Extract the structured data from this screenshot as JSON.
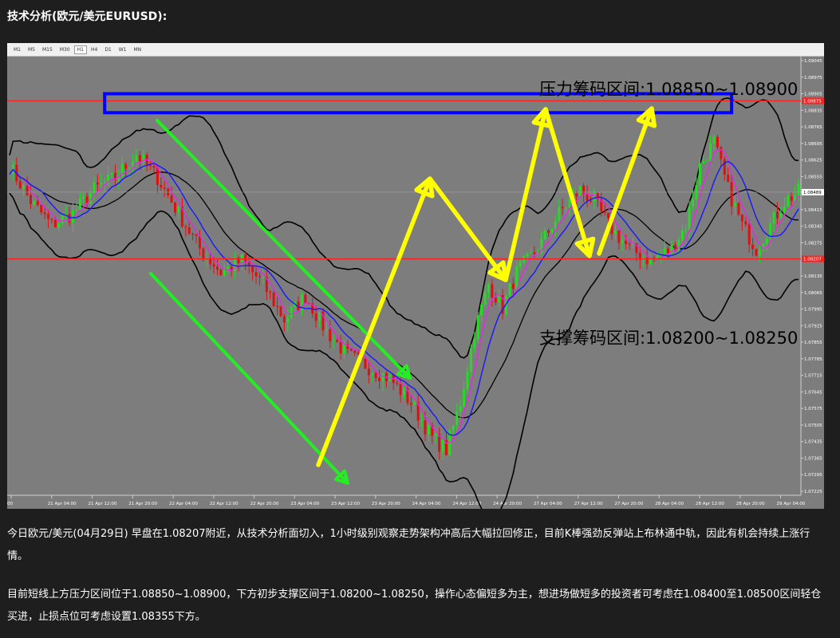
{
  "heading": "技术分析(欧元/美元EURUSD):",
  "timeframes": [
    "M1",
    "M5",
    "M15",
    "M30",
    "H1",
    "H4",
    "D1",
    "W1",
    "MN"
  ],
  "active_timeframe": "H1",
  "colors": {
    "background": "#1e1e1e",
    "chart_bg": "#7d7d7d",
    "up_candle": "#22dd22",
    "down_candle": "#e01010",
    "band_line": "#000000",
    "mid_line": "#1818ff",
    "ma_line": "#ee22ee",
    "level_line": "#ff2020",
    "resistance_box": "#0000ff",
    "arrow_yellow": "#ffff00",
    "channel_green": "#22ee22"
  },
  "chart_data": {
    "type": "candlestick",
    "symbol": "EURUSD",
    "timeframe": "H1",
    "ylim": [
      1.07225,
      1.09045
    ],
    "y_ticks": [
      "1.09045",
      "1.08975",
      "1.08905",
      "1.08835",
      "1.08765",
      "1.08695",
      "1.08625",
      "1.08555",
      "1.08489",
      "1.08415",
      "1.08345",
      "1.08275",
      "1.08207",
      "1.08135",
      "1.08065",
      "1.07995",
      "1.07925",
      "1.07855",
      "1.07785",
      "1.07715",
      "1.07645",
      "1.07575",
      "1.07505",
      "1.07435",
      "1.07365",
      "1.07295",
      "1.07225"
    ],
    "x_ticks": [
      "00",
      "21 Apr 04:00",
      "21 Apr 12:00",
      "21 Apr 20:00",
      "22 Apr 04:00",
      "22 Apr 12:00",
      "22 Apr 20:00",
      "23 Apr 04:00",
      "23 Apr 12:00",
      "23 Apr 20:00",
      "24 Apr 04:00",
      "24 Apr 12:00",
      "24 Apr 20:00",
      "27 Apr 04:00",
      "27 Apr 12:00",
      "27 Apr 20:00",
      "28 Apr 04:00",
      "28 Apr 12:00",
      "28 Apr 20:00",
      "29 Apr 04:00"
    ],
    "resistance_level_label": "1.08875",
    "current_price_label": "1.08489",
    "support_level_label": "1.08207",
    "resistance_zone": [
      1.0885,
      1.089
    ],
    "support_zone": [
      1.082,
      1.0825
    ],
    "annotations": {
      "resistance_text": "压力筹码区间:1.08850~1.08900",
      "support_text": "支撑筹码区间:1.08200~1.08250"
    },
    "close_path": [
      [
        0,
        1.086
      ],
      [
        6,
        1.0845
      ],
      [
        12,
        1.0835
      ],
      [
        18,
        1.084
      ],
      [
        24,
        1.085
      ],
      [
        30,
        1.0855
      ],
      [
        36,
        1.0865
      ],
      [
        42,
        1.0855
      ],
      [
        48,
        1.084
      ],
      [
        54,
        1.0825
      ],
      [
        60,
        1.0815
      ],
      [
        66,
        1.082
      ],
      [
        72,
        1.081
      ],
      [
        78,
        1.0795
      ],
      [
        84,
        1.0805
      ],
      [
        90,
        1.079
      ],
      [
        96,
        1.078
      ],
      [
        102,
        1.0775
      ],
      [
        108,
        1.077
      ],
      [
        114,
        1.076
      ],
      [
        120,
        1.0745
      ],
      [
        124,
        1.074
      ],
      [
        128,
        1.076
      ],
      [
        132,
        1.079
      ],
      [
        136,
        1.081
      ],
      [
        140,
        1.08
      ],
      [
        144,
        1.0815
      ],
      [
        150,
        1.0825
      ],
      [
        156,
        1.084
      ],
      [
        162,
        1.085
      ],
      [
        166,
        1.0845
      ],
      [
        170,
        1.0835
      ],
      [
        176,
        1.0825
      ],
      [
        182,
        1.082
      ],
      [
        188,
        1.0825
      ],
      [
        192,
        1.0835
      ],
      [
        196,
        1.086
      ],
      [
        200,
        1.087
      ],
      [
        204,
        1.085
      ],
      [
        208,
        1.0835
      ],
      [
        212,
        1.0825
      ],
      [
        216,
        1.0835
      ],
      [
        220,
        1.0845
      ],
      [
        224,
        1.0849
      ]
    ]
  },
  "article": {
    "paragraph1": "今日欧元/美元(04月29日) 早盘在1.08207附近，从技术分析面切入，1小时级别观察走势架构冲高后大幅拉回修正，目前K棒强劲反弹站上布林通中轨，因此有机会持续上涨行情。",
    "paragraph2": "目前短线上方压力区间位于1.08850~1.08900，下方初步支撑区间于1.08200~1.08250，操作心态偏短多为主，想进场做短多的投资者可考虑在1.08400至1.08500区间轻仓买进，止损点位可考虑设置1.08355下方。"
  }
}
